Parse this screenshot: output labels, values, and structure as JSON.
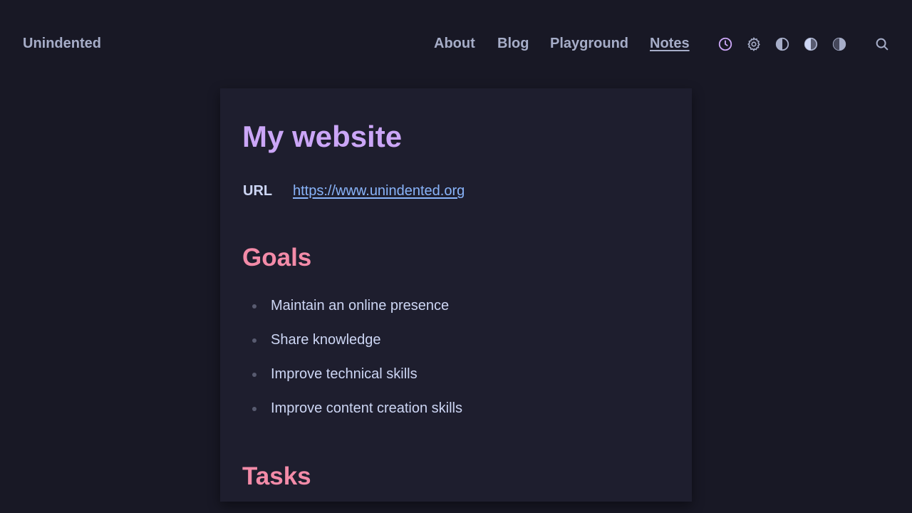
{
  "header": {
    "brand": "Unindented",
    "nav": [
      {
        "label": "About",
        "active": false
      },
      {
        "label": "Blog",
        "active": false
      },
      {
        "label": "Playground",
        "active": false
      },
      {
        "label": "Notes",
        "active": true
      }
    ],
    "icons": [
      "clock-icon",
      "gear-icon",
      "contrast-icon",
      "contrast-icon",
      "contrast-icon",
      "search-icon"
    ]
  },
  "note": {
    "title": "My website",
    "url_label": "URL",
    "url": "https://www.unindented.org",
    "sections": [
      {
        "heading": "Goals",
        "items": [
          "Maintain an online presence",
          "Share knowledge",
          "Improve technical skills",
          "Improve content creation skills"
        ]
      },
      {
        "heading": "Tasks",
        "items": []
      }
    ]
  },
  "colors": {
    "background": "#181825",
    "card": "#1e1e2e",
    "title": "#cba6f7",
    "heading": "#f38ba8",
    "link": "#89b4fa",
    "text": "#cdd6f4",
    "nav": "#a6adc8",
    "accent_icon": "#cba6f7"
  }
}
